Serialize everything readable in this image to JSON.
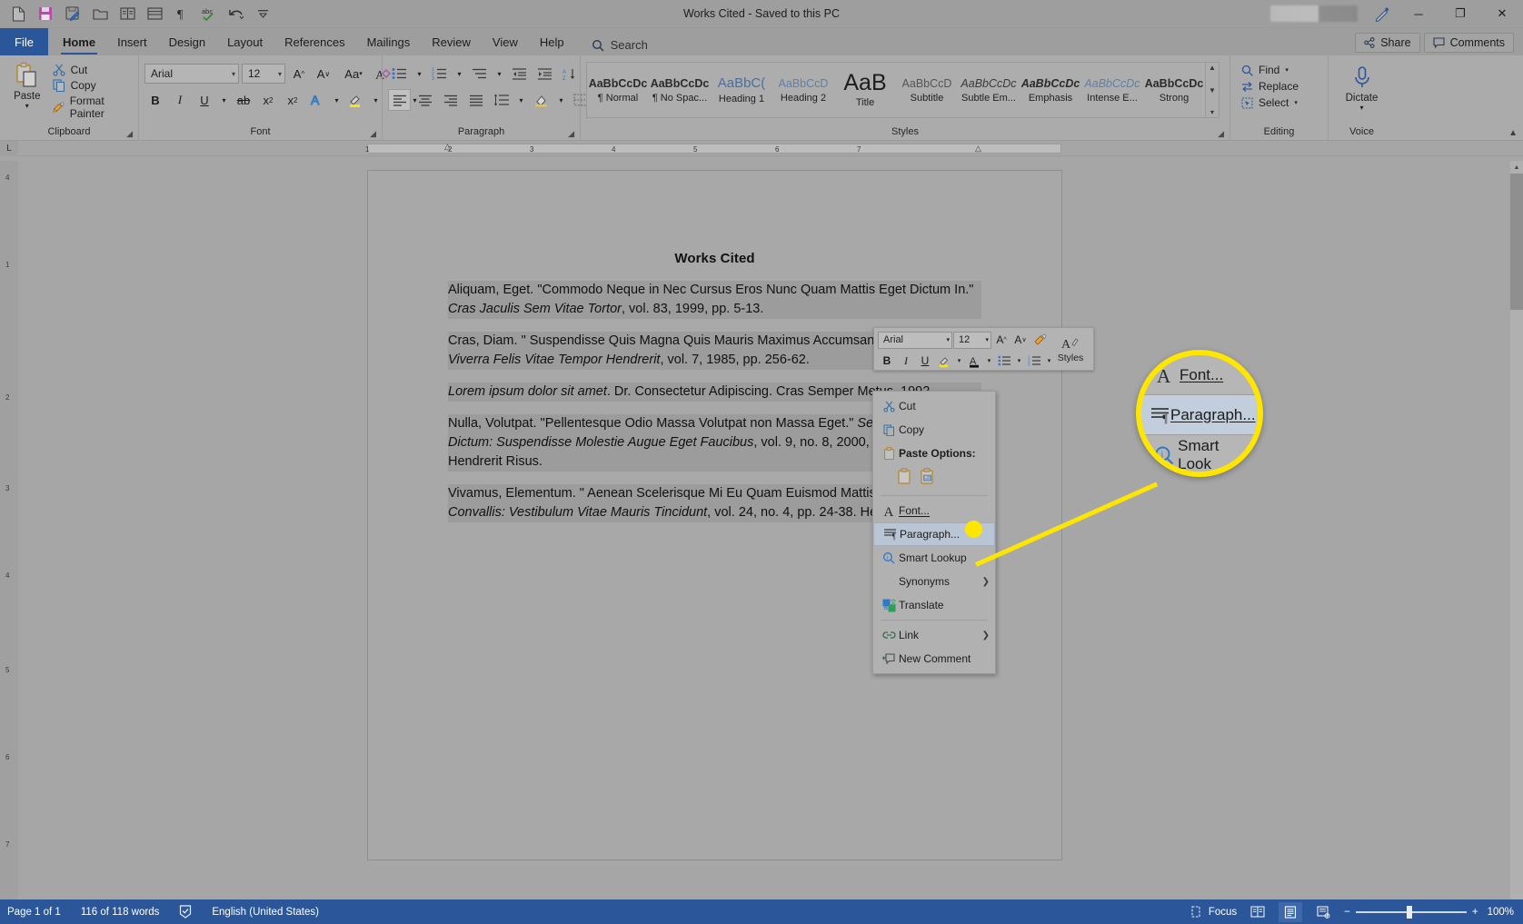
{
  "titlebar": {
    "title": "Works Cited  -  Saved to this PC",
    "quick_access": [
      {
        "name": "new-document-icon",
        "label": "New"
      },
      {
        "name": "save-icon",
        "label": "Save"
      },
      {
        "name": "save-edit-icon",
        "label": "Save As"
      },
      {
        "name": "open-folder-icon",
        "label": "Open"
      },
      {
        "name": "read-mode-icon",
        "label": "Read Mode"
      },
      {
        "name": "print-layout-icon",
        "label": "Print Layout"
      },
      {
        "name": "formatting-marks-icon",
        "label": "Show Formatting Marks"
      },
      {
        "name": "spelling-check-icon",
        "label": "Spelling & Grammar"
      },
      {
        "name": "undo-icon",
        "label": "Undo"
      },
      {
        "name": "customize-qat-icon",
        "label": "Customize Quick Access Toolbar"
      }
    ],
    "window_buttons": {
      "minimize": "─",
      "restore": "❐",
      "close": "✕"
    }
  },
  "tabs": {
    "file": "File",
    "items": [
      "Home",
      "Insert",
      "Design",
      "Layout",
      "References",
      "Mailings",
      "Review",
      "View",
      "Help"
    ],
    "active": "Home",
    "search_placeholder": "Search",
    "share_label": "Share",
    "comments_label": "Comments"
  },
  "ribbon": {
    "clipboard": {
      "group_label": "Clipboard",
      "paste_label": "Paste",
      "items": [
        "Cut",
        "Copy",
        "Format Painter"
      ]
    },
    "font": {
      "group_label": "Font",
      "font_family": "Arial",
      "font_size": "12",
      "buttons": [
        "Grow Font",
        "Shrink Font",
        "Change Case",
        "Clear Formatting",
        "Bold",
        "Italic",
        "Underline",
        "Strikethrough",
        "Subscript",
        "Superscript",
        "Text Effects",
        "Text Highlight Color",
        "Font Color"
      ]
    },
    "paragraph": {
      "group_label": "Paragraph"
    },
    "styles": {
      "group_label": "Styles",
      "items": [
        {
          "preview": "AaBbCcDc",
          "name": "¶ Normal"
        },
        {
          "preview": "AaBbCcDc",
          "name": "¶ No Spac..."
        },
        {
          "preview": "AaBbC(",
          "name": "Heading 1"
        },
        {
          "preview": "AaBbCcD",
          "name": "Heading 2"
        },
        {
          "preview": "AaB",
          "name": "Title"
        },
        {
          "preview": "AaBbCcD",
          "name": "Subtitle"
        },
        {
          "preview": "AaBbCcDc",
          "name": "Subtle Em..."
        },
        {
          "preview": "AaBbCcDc",
          "name": "Emphasis"
        },
        {
          "preview": "AaBbCcDc",
          "name": "Intense E..."
        },
        {
          "preview": "AaBbCcDc",
          "name": "Strong"
        }
      ]
    },
    "editing": {
      "group_label": "Editing",
      "items": [
        "Find",
        "Replace",
        "Select"
      ]
    },
    "voice": {
      "group_label": "Voice",
      "dictate_label": "Dictate"
    }
  },
  "ruler": {
    "marks": [
      "1",
      "2",
      "3",
      "4",
      "5",
      "6",
      "7"
    ]
  },
  "document": {
    "title": "Works Cited",
    "paragraphs": [
      {
        "id": "entry-1",
        "runs": [
          {
            "text": "Aliquam, Eget. \"Commodo Neque in Nec Cursus Eros Nunc Quam Mattis Eget Dictum In.\" ",
            "style": "normal"
          },
          {
            "text": "Cras Jaculis Sem Vitae Tortor",
            "style": "italic"
          },
          {
            "text": ", vol. 83, 1999, pp. 5-13.",
            "style": "normal"
          }
        ]
      },
      {
        "id": "entry-2",
        "runs": [
          {
            "text": "Cras, Diam. \" Suspendisse Quis Magna Quis Mauris Maximus Accumsan Dui.\" ",
            "style": "normal"
          },
          {
            "text": "Fusce Viverra Felis Vitae Tempor Hendrerit",
            "style": "italic"
          },
          {
            "text": ", vol. 7, 1985, pp. 256-62.",
            "style": "normal"
          }
        ]
      },
      {
        "id": "entry-3",
        "runs": [
          {
            "text": "Lorem ipsum dolor sit amet",
            "style": "italic"
          },
          {
            "text": ". Dr. Consectetur Adipiscing. Cras Semper Metus, 1992.",
            "style": "normal"
          }
        ]
      },
      {
        "id": "entry-4",
        "runs": [
          {
            "text": "Nulla, Volutpat. \"Pellentesque Odio Massa Volutpat non Massa Eget.\" ",
            "style": "normal"
          },
          {
            "text": "Sed Arcu Vitae Dictum: Suspendisse Molestie Augue Eget Faucibus",
            "style": "italic"
          },
          {
            "text": ", vol. 9, no. 8, 2000, pp. 349-56. Hendrerit Risus.",
            "style": "normal"
          }
        ]
      },
      {
        "id": "entry-5",
        "runs": [
          {
            "text": "Vivamus, Elementum. \" Aenean Scelerisque Mi Eu Quam Euismod Mattis. ",
            "style": "normal"
          },
          {
            "text": "Luctus Feugiat Convallis: Vestibulum Vitae Mauris Tincidunt",
            "style": "italic"
          },
          {
            "text": ", vol. 24, no. 4, pp. 24-38. Hendrerit Risus.",
            "style": "normal"
          }
        ]
      }
    ]
  },
  "mini_toolbar": {
    "font_family": "Arial",
    "font_size": "12",
    "styles_label": "Styles",
    "buttons": [
      "Grow Font",
      "Shrink Font",
      "Format Painter",
      "Styles",
      "Bold",
      "Italic",
      "Underline",
      "Text Highlight Color",
      "Font Color",
      "Bullets",
      "Numbering"
    ]
  },
  "context_menu": {
    "items": [
      {
        "label": "Cut",
        "icon": "scissors-icon",
        "type": "item"
      },
      {
        "label": "Copy",
        "icon": "copy-icon",
        "type": "item"
      },
      {
        "label": "Paste Options:",
        "icon": "paste-icon",
        "type": "header"
      },
      {
        "label": "",
        "icon": "paste-options-row",
        "type": "paste-row"
      },
      {
        "label": "Font...",
        "icon": "font-a-icon",
        "type": "item"
      },
      {
        "label": "Paragraph...",
        "icon": "paragraph-icon",
        "type": "item",
        "selected": true
      },
      {
        "label": "Smart Lookup",
        "icon": "smart-lookup-icon",
        "type": "item"
      },
      {
        "label": "Synonyms",
        "icon": "",
        "type": "submenu"
      },
      {
        "label": "Translate",
        "icon": "translate-icon",
        "type": "item"
      },
      {
        "label": "Link",
        "icon": "link-icon",
        "type": "submenu"
      },
      {
        "label": "New Comment",
        "icon": "new-comment-icon",
        "type": "item"
      }
    ]
  },
  "callout": {
    "items": [
      {
        "label": "Font...",
        "icon": "font-a-icon",
        "selected": false
      },
      {
        "label": "Paragraph...",
        "icon": "paragraph-icon",
        "selected": true
      },
      {
        "label": "Smart Look",
        "icon": "smart-lookup-icon",
        "selected": false
      }
    ],
    "highlight_color": "#ffe600"
  },
  "statusbar": {
    "page": "Page 1 of 1",
    "words": "116 of 118 words",
    "language": "English (United States)",
    "focus_label": "Focus",
    "zoom": "100%",
    "views": [
      "Read Mode",
      "Print Layout",
      "Web Layout"
    ],
    "zoom_out": "−",
    "zoom_in": "+"
  },
  "colors": {
    "accent": "#2b579a",
    "highlight": "#ffe600",
    "selection": "#9c9c9c"
  }
}
